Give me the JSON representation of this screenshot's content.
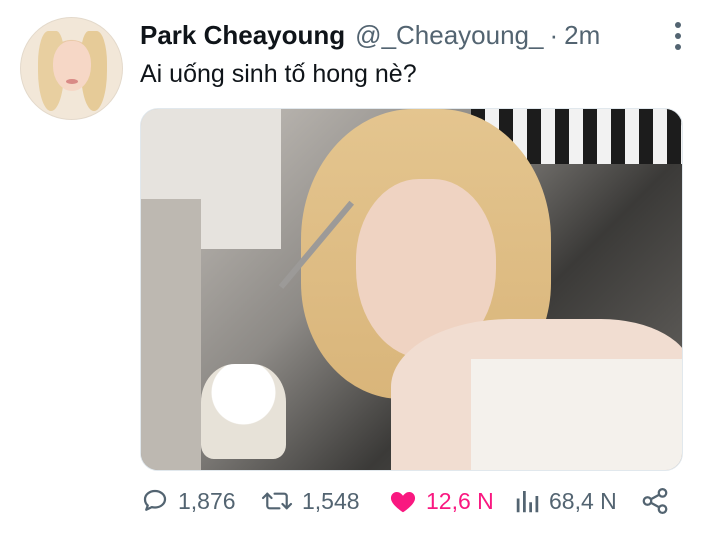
{
  "tweet": {
    "display_name": "Park Cheayoung",
    "handle": "@_Cheayoung_",
    "separator": "·",
    "time": "2m",
    "text": "Ai uống sinh tố hong nè?",
    "replies": "1,876",
    "retweets": "1,548",
    "likes": "12,6 N",
    "views": "68,4 N",
    "liked": true
  },
  "colors": {
    "primary_text": "#0f1419",
    "secondary_text": "#536471",
    "like_pink": "#f91880"
  },
  "icons": {
    "more": "vertical-ellipsis-icon",
    "reply": "comment-icon",
    "retweet": "retweet-icon",
    "like": "heart-filled-icon",
    "views": "bar-chart-icon",
    "share": "share-icon"
  }
}
